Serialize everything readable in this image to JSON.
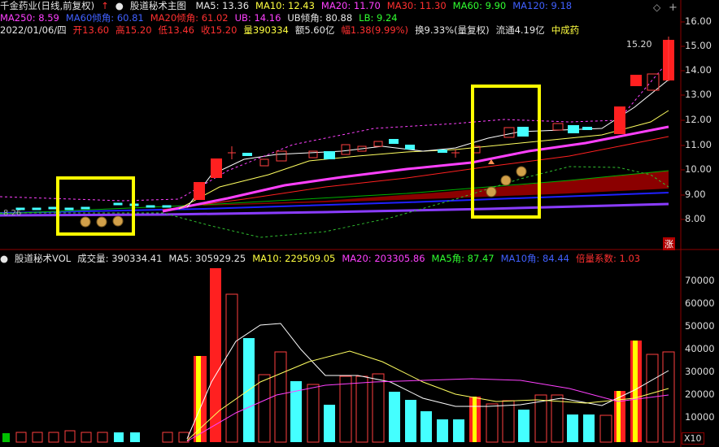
{
  "header": {
    "stock": "千金药业(日线,前复权)",
    "indicator": "股道秘术主图",
    "ma5": "MA5: 13.36",
    "ma10": "MA10: 12.43",
    "ma20": "MA20: 11.70",
    "ma30": "MA30: 11.30",
    "ma60": "MA60: 9.90",
    "ma120": "MA120: 9.18",
    "ma250": "MA250: 8.59",
    "ma60angle": "MA60倾角: 60.81",
    "ma20angle": "MA20倾角: 61.02",
    "ub": "UB: 14.16",
    "ubangle": "UB倾角: 80.88",
    "lb": "LB: 9.24",
    "date": "2022/01/06/四",
    "open": "开13.60",
    "high": "高15.20",
    "low": "低13.46",
    "close": "收15.20",
    "vol": "量390334",
    "amt": "额5.60亿",
    "chg": "幅1.38(9.99%)",
    "turn": "换9.33%(量复权)",
    "float": "流通4.19亿",
    "industry": "中成药"
  },
  "price_axis": [
    "16.00",
    "15.00",
    "14.00",
    "13.00",
    "12.00",
    "11.00",
    "10.00",
    "9.00",
    "8.00"
  ],
  "max_label": "15.20",
  "left_label": "8.26",
  "zhang": "涨",
  "vol_header": {
    "name": "股道秘术VOL",
    "vol": "成交量: 390334.41",
    "ma5": "MA5: 305929.25",
    "ma10": "MA10: 229509.05",
    "ma20": "MA20: 203305.86",
    "ma5angle": "MA5角: 87.47",
    "ma10angle": "MA10角: 84.44",
    "ratio": "倍量系数: 1.03"
  },
  "vol_axis": [
    "70000",
    "60000",
    "50000",
    "40000",
    "30000",
    "20000",
    "10000"
  ],
  "x10": "X10",
  "controls": {
    "diamond": "◇",
    "plus": "+"
  }
}
